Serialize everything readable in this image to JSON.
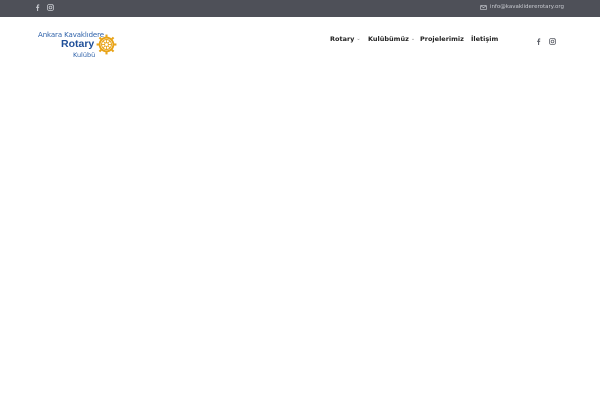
{
  "topbar": {
    "social_icons": [
      "facebook-icon",
      "instagram-icon"
    ],
    "email": "info@kavaklidererotary.org",
    "background": "#4e5058"
  },
  "header": {
    "logo": {
      "line1": "Ankara Kavaklıdere",
      "line2": "Rotary",
      "line3": "Kulübü",
      "brand_blue": "#1f4f99",
      "wheel_gold": "#e8a317"
    },
    "nav": [
      {
        "label": "Rotary",
        "has_dropdown": true
      },
      {
        "label": "Kulübümüz",
        "has_dropdown": true
      },
      {
        "label": "Projelerimiz",
        "has_dropdown": false
      },
      {
        "label": "İletişim",
        "has_dropdown": false
      }
    ],
    "social_icons": [
      "facebook-icon",
      "instagram-icon"
    ]
  }
}
